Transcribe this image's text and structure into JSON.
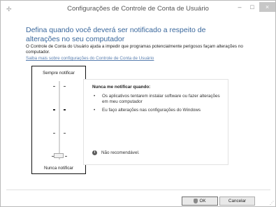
{
  "window": {
    "title": "Configurações de Controle de Conta de Usuário",
    "controls": {
      "minimize": "–",
      "maximize": "□",
      "close": "×"
    }
  },
  "main": {
    "heading": "Defina quando você deverá ser notificado a respeito de alterações no seu computador",
    "description": "O Controle de Conta do Usuário ajuda a impedir que programas potencialmente perigosos façam alterações no computador.",
    "link": "Saiba mais sobre configurações do Controle de Conta de Usuário"
  },
  "slider": {
    "top_label": "Sempre notificar",
    "bottom_label": "Nunca notificar",
    "levels": 4,
    "selected_level": 0
  },
  "info": {
    "title": "Nunca me notificar quando:",
    "bullets": [
      "Os aplicativos tentarem instalar software ou fazer alterações em meu computador",
      "Eu faço alterações nas configurações do Windows"
    ],
    "note": "Não recomendável."
  },
  "buttons": {
    "ok": "OK",
    "cancel": "Cancelar"
  },
  "colors": {
    "heading": "#39679c",
    "link": "#5a7fb0"
  }
}
